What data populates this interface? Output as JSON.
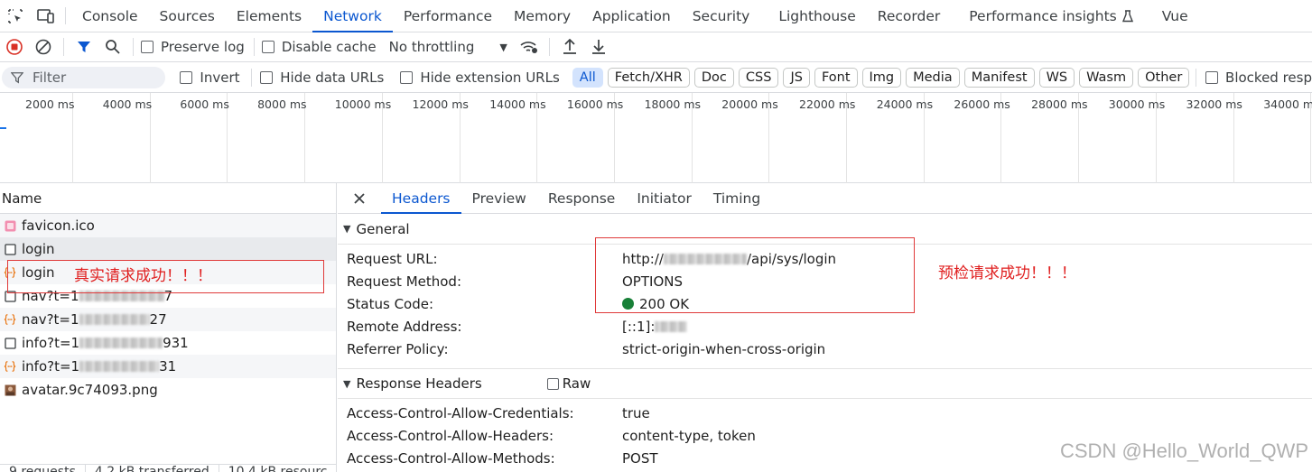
{
  "tabs": [
    "Console",
    "Sources",
    "Elements",
    "Network",
    "Performance",
    "Memory",
    "Application",
    "Security",
    "Lighthouse",
    "Recorder",
    "Performance insights",
    "Vue"
  ],
  "active_tab": "Network",
  "toolbar": {
    "preserve_log": "Preserve log",
    "disable_cache": "Disable cache",
    "throttling": "No throttling"
  },
  "filter": {
    "placeholder": "Filter",
    "invert": "Invert",
    "hide_data_urls": "Hide data URLs",
    "hide_extension_urls": "Hide extension URLs",
    "types": [
      "All",
      "Fetch/XHR",
      "Doc",
      "CSS",
      "JS",
      "Font",
      "Img",
      "Media",
      "Manifest",
      "WS",
      "Wasm",
      "Other"
    ],
    "active_type": "All",
    "blocked": "Blocked resp"
  },
  "overview": {
    "ticks": [
      "2000 ms",
      "4000 ms",
      "6000 ms",
      "8000 ms",
      "10000 ms",
      "12000 ms",
      "14000 ms",
      "16000 ms",
      "18000 ms",
      "20000 ms",
      "22000 ms",
      "24000 ms",
      "26000 ms",
      "28000 ms",
      "30000 ms",
      "32000 ms",
      "34000 ms"
    ]
  },
  "requests": {
    "header": "Name",
    "rows": [
      {
        "pre": "favicon.ico",
        "post": "",
        "icon": "favicon-icon"
      },
      {
        "pre": "login",
        "post": "",
        "icon": "document-icon"
      },
      {
        "pre": "login",
        "post": "",
        "icon": "xhr-icon"
      },
      {
        "pre": "nav?t=1",
        "post": "7",
        "icon": "document-icon"
      },
      {
        "pre": "nav?t=1",
        "post": "27",
        "icon": "xhr-icon"
      },
      {
        "pre": "info?t=1",
        "post": "931",
        "icon": "document-icon"
      },
      {
        "pre": "info?t=1",
        "post": "31",
        "icon": "xhr-icon"
      },
      {
        "pre": "avatar.9c74093.png",
        "post": "",
        "icon": "image-icon"
      }
    ],
    "footer": [
      "9 requests",
      "4.2 kB transferred",
      "10.4 kB resourc"
    ]
  },
  "details": {
    "tabs": [
      "Headers",
      "Preview",
      "Response",
      "Initiator",
      "Timing"
    ],
    "active_tab": "Headers",
    "general_title": "General",
    "general": {
      "request_url_label": "Request URL:",
      "request_url_pre": "http://",
      "request_url_post": "/api/sys/login",
      "request_method_label": "Request Method:",
      "request_method": "OPTIONS",
      "status_code_label": "Status Code:",
      "status_code": "200 OK",
      "remote_address_label": "Remote Address:",
      "remote_address_pre": "[::1]:",
      "referrer_policy_label": "Referrer Policy:",
      "referrer_policy": "strict-origin-when-cross-origin"
    },
    "response_headers_title": "Response Headers",
    "raw_label": "Raw",
    "response_headers": [
      {
        "k": "Access-Control-Allow-Credentials:",
        "v": "true"
      },
      {
        "k": "Access-Control-Allow-Headers:",
        "v": "content-type, token"
      },
      {
        "k": "Access-Control-Allow-Methods:",
        "v": "POST"
      }
    ]
  },
  "annotations": {
    "real_request": "真实请求成功！！！",
    "preflight": "预检请求成功！！！"
  },
  "watermark": "CSDN @Hello_World_QWP",
  "colors": {
    "accent": "#0b57d0",
    "record": "#d93025",
    "status_ok": "#188038",
    "annotation": "#e02020"
  }
}
